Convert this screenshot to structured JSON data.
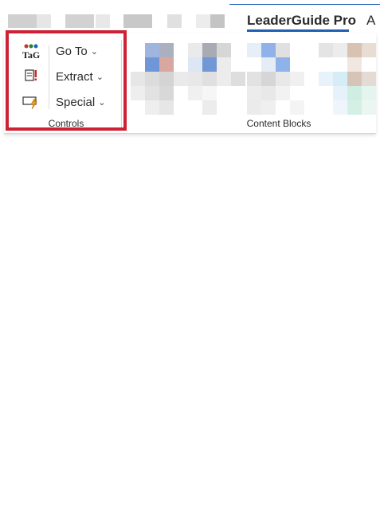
{
  "tabs": {
    "active_label": "LeaderGuide Pro",
    "next_label": "A"
  },
  "controls_group": {
    "label": "Controls",
    "icons": [
      "tag-icon",
      "document-alert-icon",
      "text-box-lightning-icon"
    ],
    "menus": [
      {
        "label": "Go To",
        "icon": "chevron-down-icon"
      },
      {
        "label": "Extract",
        "icon": "chevron-down-icon"
      },
      {
        "label": "Special",
        "icon": "chevron-down-icon"
      }
    ]
  },
  "content_blocks_group": {
    "label": "Content Blocks"
  },
  "colors": {
    "highlight": "#cc2233",
    "accent": "#1f5fb4"
  }
}
